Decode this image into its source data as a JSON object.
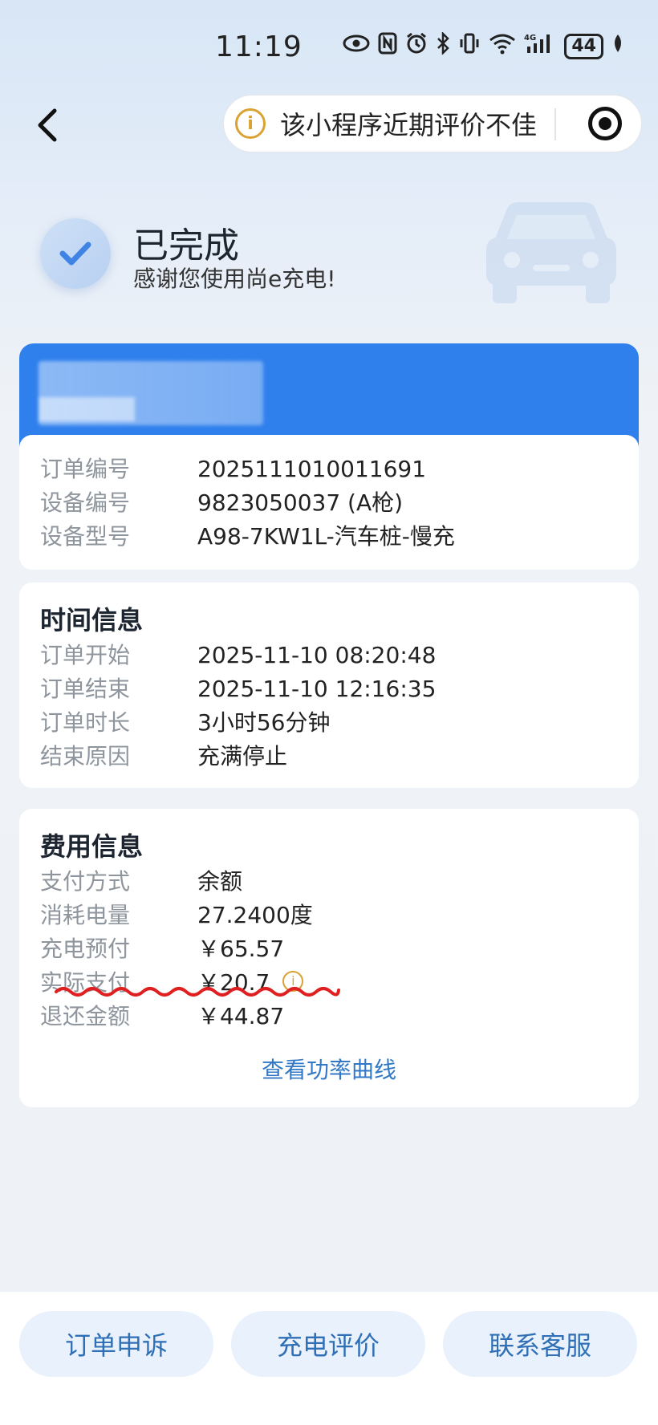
{
  "status_bar": {
    "time": "11:19",
    "battery": "44"
  },
  "capsule": {
    "warning_text": "该小程序近期评价不佳",
    "warn_glyph": "i"
  },
  "header": {
    "title": "已完成",
    "subtitle": "感谢您使用尚e充电!"
  },
  "order_info": {
    "rows": [
      {
        "label": "订单编号",
        "value": "2025111010011691"
      },
      {
        "label": "设备编号",
        "value": "9823050037 (A枪)"
      },
      {
        "label": "设备型号",
        "value": "A98-7KW1L-汽车桩-慢充"
      }
    ]
  },
  "time_info": {
    "title": "时间信息",
    "rows": [
      {
        "label": "订单开始",
        "value": "2025-11-10 08:20:48"
      },
      {
        "label": "订单结束",
        "value": "2025-11-10 12:16:35"
      },
      {
        "label": "订单时长",
        "value": "3小时56分钟"
      },
      {
        "label": "结束原因",
        "value": "充满停止"
      }
    ]
  },
  "fee_info": {
    "title": "费用信息",
    "rows": [
      {
        "label": "支付方式",
        "value": "余额"
      },
      {
        "label": "消耗电量",
        "value": "27.2400度"
      },
      {
        "label": "充电预付",
        "value": "￥65.57"
      },
      {
        "label": "实际支付",
        "value": "￥20.7"
      },
      {
        "label": "退还金额",
        "value": "￥44.87"
      }
    ],
    "power_curve_link": "查看功率曲线"
  },
  "bottom_actions": {
    "appeal": "订单申诉",
    "review": "充电评价",
    "service": "联系客服"
  },
  "colors": {
    "primary": "#2f80ed",
    "link": "#3178c6",
    "warning": "#d9a233",
    "annotation": "#e02020"
  }
}
